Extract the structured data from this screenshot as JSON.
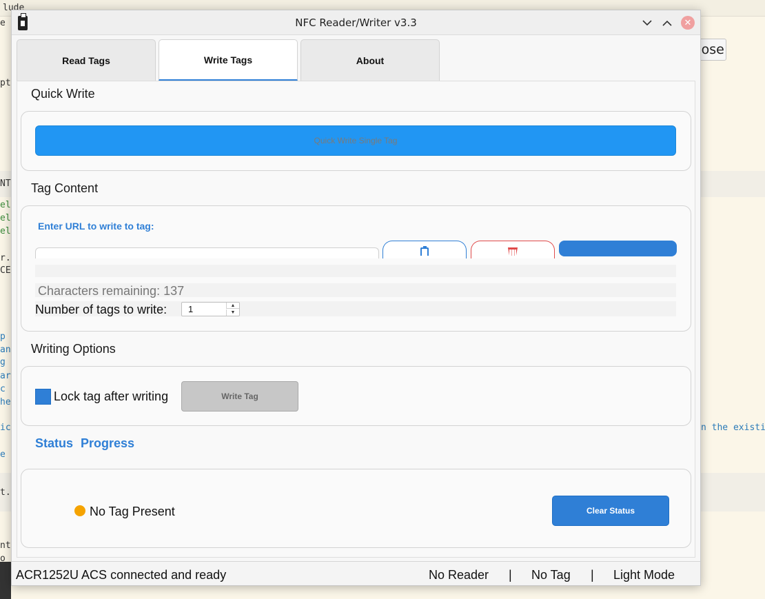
{
  "background": {
    "lines": [
      {
        "text": "lude",
        "cls": ""
      },
      {
        "text": "e",
        "cls": ""
      },
      {
        "text": "pts",
        "cls": ""
      },
      {
        "text": "NTS",
        "cls": ""
      },
      {
        "text": "el",
        "cls": "green"
      },
      {
        "text": "el",
        "cls": "green"
      },
      {
        "text": "el",
        "cls": "green"
      },
      {
        "text": "r.",
        "cls": ""
      },
      {
        "text": "CE",
        "cls": ""
      },
      {
        "text": "p",
        "cls": "blue"
      },
      {
        "text": "an",
        "cls": "blue"
      },
      {
        "text": "g",
        "cls": "blue"
      },
      {
        "text": "ar",
        "cls": "blue"
      },
      {
        "text": "c",
        "cls": "blue"
      },
      {
        "text": "he",
        "cls": "blue"
      },
      {
        "text": "ic",
        "cls": "blue"
      },
      {
        "text": "e",
        "cls": "blue"
      },
      {
        "text": "t.",
        "cls": ""
      },
      {
        "text": "nt",
        "cls": ""
      },
      {
        "text": "o",
        "cls": ""
      }
    ],
    "right_snippet": "n the existi",
    "close_label": "Close"
  },
  "window": {
    "title": "NFC Reader/Writer v3.3"
  },
  "tabs": [
    {
      "label": "Read Tags",
      "active": false
    },
    {
      "label": "Write Tags",
      "active": true
    },
    {
      "label": "About",
      "active": false
    }
  ],
  "quick_write": {
    "title": "Quick Write",
    "button_label": "Quick Write Single Tag"
  },
  "tag_content": {
    "title": "Tag Content",
    "url_label": "Enter URL to write to tag:",
    "url_value": "",
    "chars_remaining": "Characters remaining: 137",
    "num_tags_label": "Number of tags to write:",
    "num_tags_value": "1"
  },
  "writing_options": {
    "title": "Writing Options",
    "lock_label": "Lock tag after writing",
    "lock_checked": true,
    "write_button_label": "Write Tag"
  },
  "status": {
    "heading": "Status Progress",
    "text": "No Tag Present",
    "indicator_color": "#f5a300",
    "clear_button_label": "Clear Status"
  },
  "statusbar": {
    "message": "ACR1252U ACS connected and ready",
    "reader": "No Reader",
    "sep1": "|",
    "tag": "No Tag",
    "sep2": "|",
    "mode": "Light Mode"
  },
  "colors": {
    "accent": "#2f7fd6",
    "quick_write": "#2196f3",
    "danger": "#e04a4a"
  }
}
